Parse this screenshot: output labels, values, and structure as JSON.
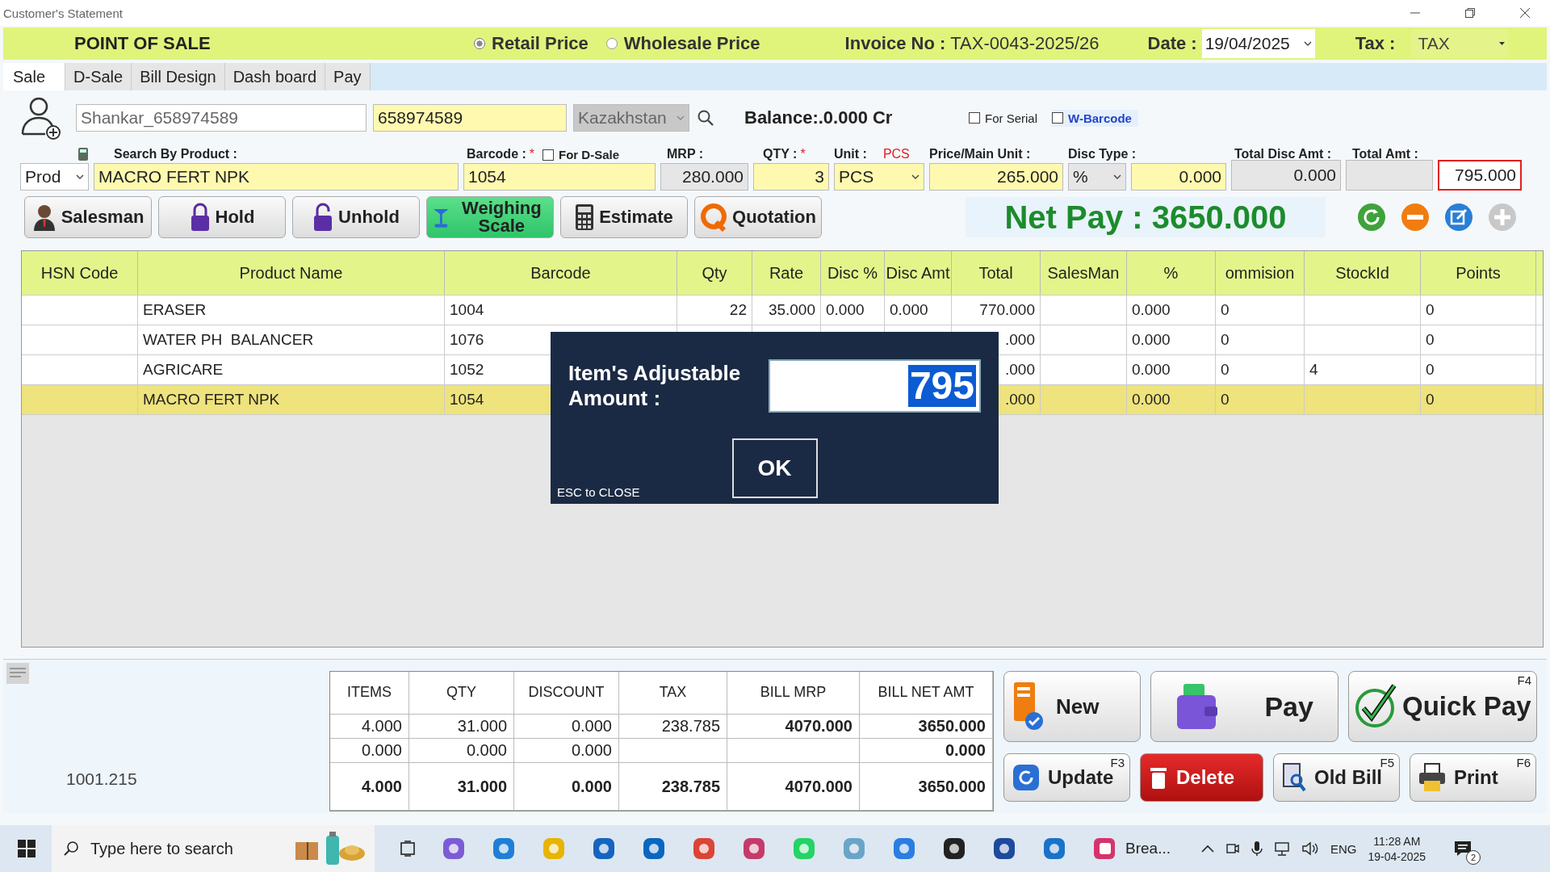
{
  "window": {
    "title": "Customer's Statement"
  },
  "header": {
    "title": "POINT OF SALE",
    "price_modes": [
      {
        "label": "Retail Price",
        "selected": true
      },
      {
        "label": "Wholesale Price",
        "selected": false
      }
    ],
    "invoice_label": "Invoice No :",
    "invoice_no": "TAX-0043-2025/26",
    "date_label": "Date :",
    "date": "19/04/2025",
    "tax_label": "Tax :",
    "tax": "TAX"
  },
  "tabs": [
    {
      "label": "Sale",
      "selected": true
    },
    {
      "label": "D-Sale",
      "selected": false
    },
    {
      "label": "Bill Design",
      "selected": false
    },
    {
      "label": "Dash board",
      "selected": false
    },
    {
      "label": "Pay",
      "selected": false
    }
  ],
  "customer": {
    "name": "Shankar_658974589",
    "phone": "658974589",
    "country": "Kazakhstan",
    "balance": "Balance:.0.000 Cr",
    "options": [
      {
        "label": "For Serial",
        "checked": false,
        "kind": "plain"
      },
      {
        "label": "W-Barcode",
        "checked": false,
        "kind": "link"
      }
    ]
  },
  "entry": {
    "search_label": "Search By Product :",
    "search_type": "Prod",
    "product": "MACRO FERT NPK",
    "barcode_label": "Barcode :",
    "required_mark": "*",
    "for_dsale": {
      "label": "For D-Sale",
      "checked": false
    },
    "barcode": "1054",
    "mrp_label": "MRP :",
    "mrp": "280.000",
    "qty_label": "QTY :",
    "qty": "3",
    "unit_label": "Unit :",
    "unit_hint": "PCS",
    "unit": "PCS",
    "price_label": "Price/Main Unit :",
    "price": "265.000",
    "disc_type_label": "Disc Type :",
    "disc_type": "%",
    "disc_value": "0.000",
    "total_disc_label": "Total Disc Amt :",
    "total_disc": "0.000",
    "total_amt_label": "Total Amt :",
    "total_amt": "795.000"
  },
  "actions": [
    "Salesman",
    "Hold",
    "Unhold",
    "Weighing Scale",
    "Estimate",
    "Quotation"
  ],
  "net_pay": "Net Pay : 3650.000",
  "table": {
    "columns": [
      "HSN Code",
      "Product Name",
      "Barcode",
      "Qty",
      "Rate",
      "Disc %",
      "Disc Amt",
      "Total",
      "SalesMan",
      "%",
      "ommision",
      "StockId",
      "Points"
    ],
    "rows": [
      {
        "selected": false,
        "cells": [
          null,
          "ERASER",
          "1004",
          "22",
          "35.000",
          "0.000",
          "0.000",
          "770.000",
          null,
          "0.000",
          "0",
          null,
          "0"
        ]
      },
      {
        "selected": false,
        "cells": [
          null,
          "WATER PH  BALANCER",
          "1076",
          null,
          null,
          null,
          null,
          ".000",
          null,
          "0.000",
          "0",
          null,
          "0"
        ]
      },
      {
        "selected": false,
        "cells": [
          null,
          "AGRICARE",
          "1052",
          null,
          null,
          null,
          null,
          ".000",
          null,
          "0.000",
          "0",
          "4",
          "0"
        ]
      },
      {
        "selected": true,
        "cells": [
          null,
          "MACRO FERT NPK",
          "1054",
          null,
          null,
          null,
          null,
          ".000",
          null,
          "0.000",
          "0",
          null,
          "0"
        ]
      }
    ]
  },
  "dialog": {
    "label": "Item's Adjustable Amount :",
    "value": "795",
    "ok": "OK",
    "hint": "ESC to CLOSE"
  },
  "footer": {
    "code": "1001.215",
    "summary": {
      "columns": [
        "ITEMS",
        "QTY",
        "DISCOUNT",
        "TAX",
        "BILL MRP",
        "BILL NET AMT"
      ],
      "rows": [
        {
          "kind": "normal",
          "cells": [
            "4.000",
            "31.000",
            "0.000",
            "238.785",
            "4070.000",
            "3650.000"
          ]
        },
        {
          "kind": "normal",
          "cells": [
            "0.000",
            "0.000",
            "0.000",
            null,
            null,
            "0.000"
          ]
        },
        {
          "kind": "total",
          "cells": [
            "4.000",
            "31.000",
            "0.000",
            "238.785",
            "4070.000",
            "3650.000"
          ]
        }
      ]
    },
    "big_buttons": [
      {
        "label": "New"
      },
      {
        "label": "Pay"
      },
      {
        "label": "Quick Pay",
        "key": "F4"
      }
    ],
    "small_buttons": [
      {
        "label": "Update",
        "key": "F3",
        "kind": "plain"
      },
      {
        "label": "Delete",
        "kind": "danger"
      },
      {
        "label": "Old Bill",
        "key": "F5",
        "kind": "plain"
      },
      {
        "label": "Print",
        "key": "F6",
        "kind": "plain"
      }
    ]
  },
  "taskbar": {
    "search_placeholder": "Type here to search",
    "app_label": "Brea...",
    "language": "ENG",
    "time": "11:28 AM",
    "date": "19-04-2025",
    "notifications": "2"
  }
}
